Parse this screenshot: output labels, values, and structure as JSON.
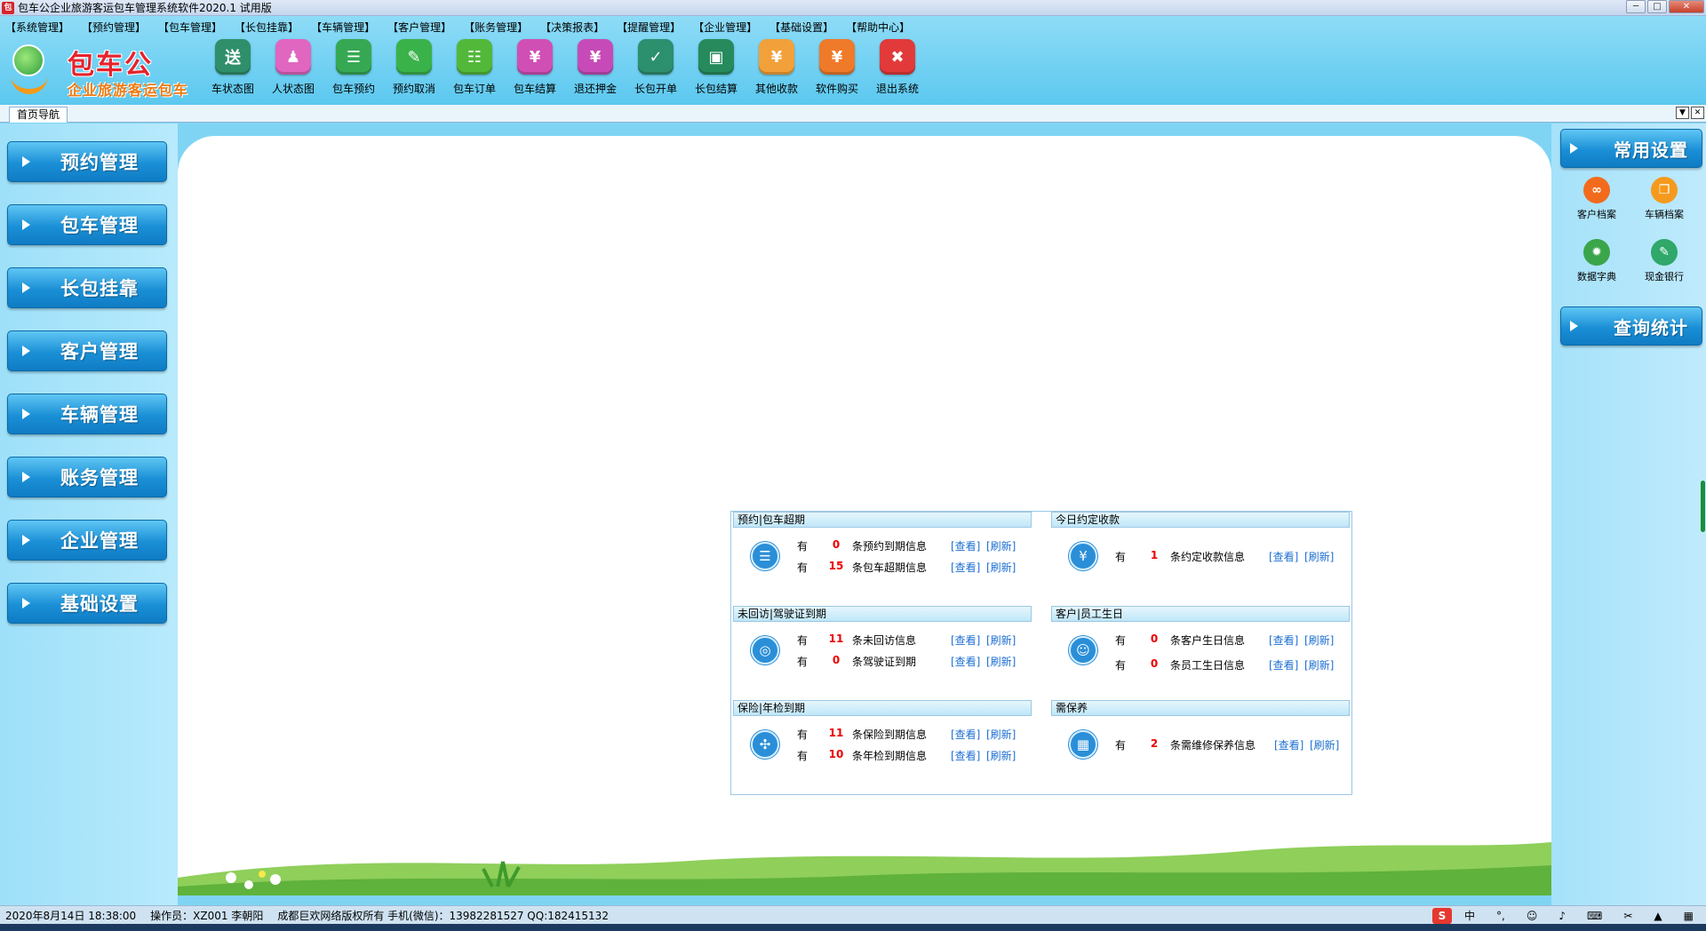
{
  "window": {
    "title": "包车公企业旅游客运包车管理系统软件2020.1 试用版",
    "app_icon_text": "包"
  },
  "menubar": [
    "【系统管理】",
    "【预约管理】",
    "【包车管理】",
    "【长包挂靠】",
    "【车辆管理】",
    "【客户管理】",
    "【账务管理】",
    "【决策报表】",
    "【提醒管理】",
    "【企业管理】",
    "【基础设置】",
    "【帮助中心】"
  ],
  "logo": {
    "brand": "包车公",
    "slogan": "企业旅游客运包车"
  },
  "toolbar": [
    {
      "label": "车状态图",
      "icon": "truck-icon",
      "glyph": "送",
      "color": "#2f8f6a"
    },
    {
      "label": "人状态图",
      "icon": "people-icon",
      "glyph": "♟",
      "color": "#e066c0"
    },
    {
      "label": "包车预约",
      "icon": "list-icon",
      "glyph": "☰",
      "color": "#36a853"
    },
    {
      "label": "预约取消",
      "icon": "edit-icon",
      "glyph": "✎",
      "color": "#3ab24a"
    },
    {
      "label": "包车订单",
      "icon": "cart-icon",
      "glyph": "☷",
      "color": "#52b83a"
    },
    {
      "label": "包车结算",
      "icon": "bill-icon",
      "glyph": "¥",
      "color": "#d04fb5"
    },
    {
      "label": "退还押金",
      "icon": "refund-icon",
      "glyph": "¥",
      "color": "#c64bb8"
    },
    {
      "label": "长包开单",
      "icon": "doc-icon",
      "glyph": "✓",
      "color": "#2c8f6e"
    },
    {
      "label": "长包结算",
      "icon": "scan-icon",
      "glyph": "▣",
      "color": "#268a5c"
    },
    {
      "label": "其他收款",
      "icon": "moneybag-icon",
      "glyph": "¥",
      "color": "#f2a13a"
    },
    {
      "label": "软件购买",
      "icon": "purchase-icon",
      "glyph": "¥",
      "color": "#ef7a2a"
    },
    {
      "label": "退出系统",
      "icon": "exit-icon",
      "glyph": "✖",
      "color": "#e23a3a"
    }
  ],
  "tab": {
    "label": "首页导航"
  },
  "leftnav": [
    "预约管理",
    "包车管理",
    "长包挂靠",
    "客户管理",
    "车辆管理",
    "账务管理",
    "企业管理",
    "基础设置"
  ],
  "rightpanel": {
    "header1": "常用设置",
    "header2": "查询统计",
    "items": [
      {
        "label": "客户档案",
        "icon": "link-icon",
        "glyph": "∞",
        "color": "#f26b1d"
      },
      {
        "label": "车辆档案",
        "icon": "book-icon",
        "glyph": "❐",
        "color": "#f59a1e"
      },
      {
        "label": "数据字典",
        "icon": "gear-icon",
        "glyph": "✹",
        "color": "#3aa54a"
      },
      {
        "label": "现金银行",
        "icon": "pencil-icon",
        "glyph": "✎",
        "color": "#2fa86a"
      }
    ]
  },
  "info": {
    "you": "有",
    "view": "[查看]",
    "refresh": "[刷新]",
    "sections": [
      {
        "title": "预约|包车超期",
        "icon": "clipboard-icon",
        "glyph": "☰",
        "rows": [
          {
            "count": "0",
            "text": "条预约到期信息"
          },
          {
            "count": "15",
            "text": "条包车超期信息"
          }
        ]
      },
      {
        "title": "今日约定收款",
        "icon": "moneybag-icon",
        "glyph": "¥",
        "rows": [
          {
            "count": "1",
            "text": "条约定收款信息"
          }
        ]
      },
      {
        "title": "未回访|驾驶证到期",
        "icon": "target-icon",
        "glyph": "◎",
        "rows": [
          {
            "count": "11",
            "text": "条未回访信息"
          },
          {
            "count": "0",
            "text": "条驾驶证到期"
          }
        ]
      },
      {
        "title": "客户|员工生日",
        "icon": "users-icon",
        "glyph": "☺",
        "rows": [
          {
            "count": "0",
            "text": "条客户生日信息"
          },
          {
            "count": "0",
            "text": "条员工生日信息"
          }
        ]
      },
      {
        "title": "保险|年检到期",
        "icon": "dots-icon",
        "glyph": "✣",
        "rows": [
          {
            "count": "11",
            "text": "条保险到期信息"
          },
          {
            "count": "10",
            "text": "条年检到期信息"
          }
        ]
      },
      {
        "title": "需保养",
        "icon": "grid-icon",
        "glyph": "▦",
        "rows": [
          {
            "count": "2",
            "text": "条需维修保养信息"
          }
        ]
      }
    ]
  },
  "statusbar": {
    "datetime": "2020年8月14日 18:38:00",
    "operator": "操作员：XZ001 李朝阳",
    "copyright": "成都巨欢网络版权所有 手机(微信)：13982281527 QQ:182415132"
  },
  "ime": {
    "logo": "S",
    "lang": "中"
  }
}
